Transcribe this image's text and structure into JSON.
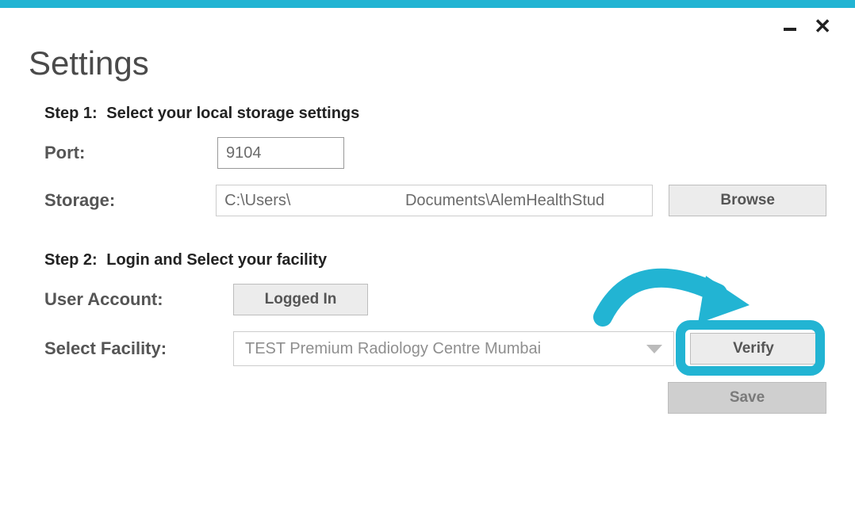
{
  "window": {
    "title": "Settings"
  },
  "step1": {
    "heading_label": "Step 1:",
    "heading_text": "Select your local storage settings",
    "port_label": "Port:",
    "port_value": "9104",
    "storage_label": "Storage:",
    "storage_value": "C:\\Users\\                          Documents\\AlemHealthStud",
    "browse_label": "Browse"
  },
  "step2": {
    "heading_label": "Step 2:",
    "heading_text": "Login and Select your facility",
    "user_account_label": "User Account:",
    "logged_in_label": "Logged In",
    "select_facility_label": "Select Facility:",
    "facility_value": "TEST Premium Radiology Centre Mumbai",
    "verify_label": "Verify",
    "save_label": "Save"
  },
  "colors": {
    "accent": "#22b4d3"
  }
}
